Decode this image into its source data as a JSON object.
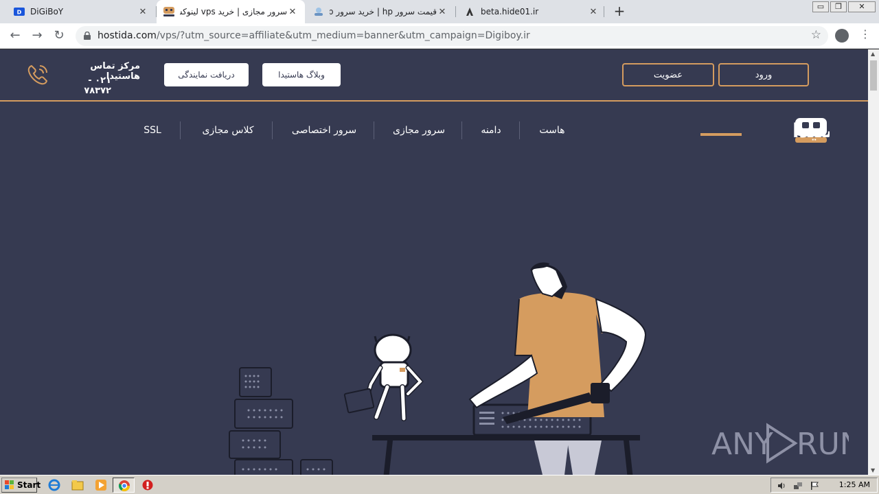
{
  "browser": {
    "tabs": [
      {
        "title": "DiGiBoY",
        "favicon": "digiboy-icon",
        "active": false
      },
      {
        "title": "سرور مجازی | خرید vps لینوکس ...",
        "favicon": "hostida-icon",
        "active": true
      },
      {
        "title": "قیمت سرور hp | خرید سرور hp با...",
        "favicon": "server-icon",
        "active": false
      },
      {
        "title": "beta.hide01.ir",
        "favicon": "hide01-icon",
        "active": false
      }
    ],
    "tab_close_glyph": "✕",
    "new_tab_glyph": "+",
    "url_host": "hostida.com",
    "url_path": "/vps/?utm_source=affiliate&utm_medium=banner&utm_campaign=Digiboy.ir",
    "window_controls": [
      "▭",
      "❐",
      "✕"
    ]
  },
  "site": {
    "header": {
      "login_label": "ورود",
      "signup_label": "عضویت",
      "blog_label": "وبلاگ هاستیدا",
      "reseller_label": "دریافت نمایندگی",
      "contact_title": "مرکز تماس هاستیدا",
      "contact_phone": "۰۲۱ - ۷۸۳۷۲"
    },
    "logo_text": "هاستیدا",
    "nav": [
      {
        "label": "هاست"
      },
      {
        "label": "دامنه"
      },
      {
        "label": "سرور مجازی"
      },
      {
        "label": "سرور اختصاصی"
      },
      {
        "label": "کلاس مجازی"
      },
      {
        "label": "SSL"
      }
    ],
    "colors": {
      "background": "#363a51",
      "accent": "#d59c5f",
      "white": "#ffffff"
    }
  },
  "watermark": {
    "text": "ANY RUN"
  },
  "taskbar": {
    "start_label": "Start",
    "clock": "1:25 AM",
    "pinned": [
      "ie-icon",
      "explorer-icon",
      "media-player-icon",
      "chrome-icon",
      "stop-icon"
    ]
  }
}
